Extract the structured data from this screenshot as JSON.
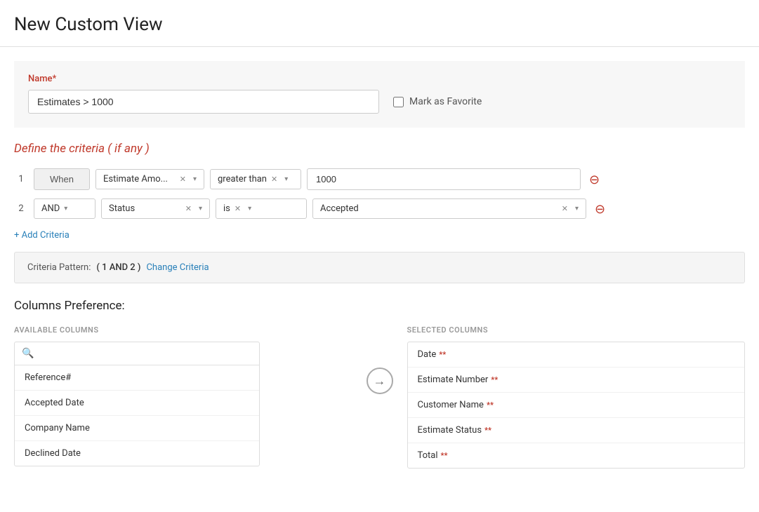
{
  "header": {
    "title": "New Custom View"
  },
  "name_section": {
    "label": "Name*",
    "value": "Estimates > 1000",
    "mark_as_favorite_label": "Mark as Favorite"
  },
  "criteria_section": {
    "title_prefix": "Define the criteria (",
    "title_highlight": " if any ",
    "title_suffix": ")",
    "rows": [
      {
        "num": "1",
        "type": "when",
        "when_label": "When",
        "field": "Estimate Amo...",
        "operator": "greater than",
        "value": "1000"
      },
      {
        "num": "2",
        "type": "and",
        "and_label": "AND",
        "field": "Status",
        "operator": "is",
        "value": "Accepted"
      }
    ],
    "add_criteria_label": "+ Add Criteria",
    "pattern_label": "Criteria Pattern:",
    "pattern_value": "( 1 AND 2 )",
    "change_criteria_label": "Change Criteria"
  },
  "columns_section": {
    "title": "Columns Preference:",
    "available_title": "AVAILABLE COLUMNS",
    "selected_title": "SELECTED COLUMNS",
    "search_placeholder": "",
    "available_items": [
      {
        "label": "Reference#"
      },
      {
        "label": "Accepted Date"
      },
      {
        "label": "Company Name"
      },
      {
        "label": "Declined Date"
      }
    ],
    "selected_items": [
      {
        "label": "Date",
        "required": true
      },
      {
        "label": "Estimate Number",
        "required": true
      },
      {
        "label": "Customer Name",
        "required": true
      },
      {
        "label": "Estimate Status",
        "required": true
      },
      {
        "label": "Total",
        "required": true
      }
    ],
    "transfer_icon": "→"
  }
}
